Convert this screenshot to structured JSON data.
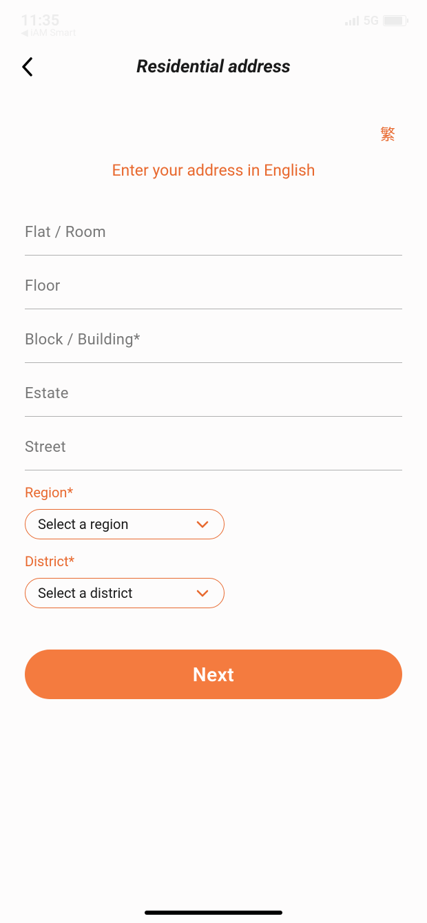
{
  "status": {
    "time": "11:35",
    "app_return": "◀ iAM Smart",
    "network": "5G"
  },
  "header": {
    "title": "Residential address"
  },
  "lang": {
    "toggle": "繁"
  },
  "subtitle": "Enter your address in English",
  "fields": {
    "flat": {
      "placeholder": "Flat / Room",
      "value": ""
    },
    "floor": {
      "placeholder": "Floor",
      "value": ""
    },
    "block": {
      "placeholder": "Block / Building*",
      "value": ""
    },
    "estate": {
      "placeholder": "Estate",
      "value": ""
    },
    "street": {
      "placeholder": "Street",
      "value": ""
    }
  },
  "region": {
    "label": "Region*",
    "selected": "Select a region"
  },
  "district": {
    "label": "District*",
    "selected": "Select a district"
  },
  "buttons": {
    "next": "Next"
  }
}
